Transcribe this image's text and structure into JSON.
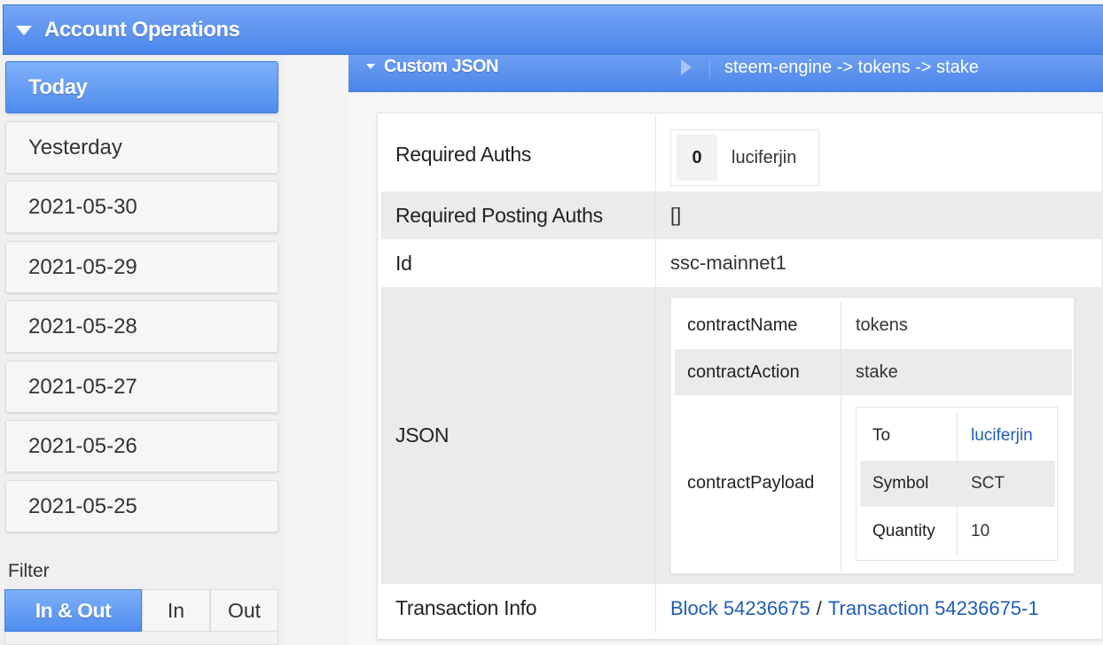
{
  "header": {
    "title": "Account Operations"
  },
  "sidebar": {
    "days": [
      "Today",
      "Yesterday",
      "2021-05-30",
      "2021-05-29",
      "2021-05-28",
      "2021-05-27",
      "2021-05-26",
      "2021-05-25"
    ],
    "active_day": "Today",
    "filter_label": "Filter",
    "filters": [
      "In & Out",
      "In",
      "Out"
    ],
    "active_filter": "In & Out"
  },
  "operation": {
    "type": "Custom JSON",
    "path": "steem-engine -> tokens -> stake",
    "rows": {
      "required_auths": {
        "label": "Required Auths",
        "index": "0",
        "account": "luciferjin"
      },
      "required_posting_auths": {
        "label": "Required Posting Auths",
        "value": "[]"
      },
      "id": {
        "label": "Id",
        "value": "ssc-mainnet1"
      },
      "json": {
        "label": "JSON",
        "contract_name": {
          "key": "contractName",
          "value": "tokens"
        },
        "contract_action": {
          "key": "contractAction",
          "value": "stake"
        },
        "contract_payload": {
          "key": "contractPayload",
          "to": {
            "key": "To",
            "value": "luciferjin"
          },
          "symbol": {
            "key": "Symbol",
            "value": "SCT"
          },
          "quantity": {
            "key": "Quantity",
            "value": "10"
          }
        }
      },
      "transaction_info": {
        "label": "Transaction Info",
        "block": "Block 54236675",
        "separator": "/",
        "transaction": "Transaction 54236675-1"
      }
    }
  },
  "colors": {
    "accent": "#4a86ea",
    "link": "#1f5db6"
  }
}
